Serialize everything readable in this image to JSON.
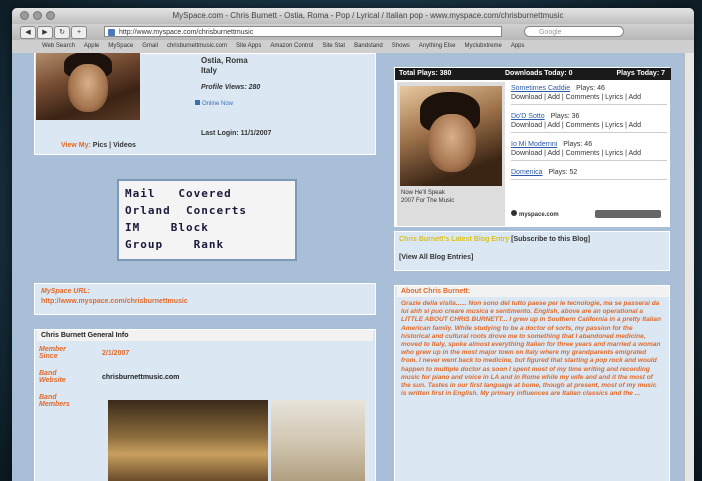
{
  "browser": {
    "window_title": "MySpace.com - Chris Burnett - Ostia, Roma - Pop / Lyrical / Italian pop - www.myspace.com/chrisburnettmusic",
    "url": "http://www.myspace.com/chrisburnettmusic",
    "search_placeholder": "Google",
    "bookmarks": [
      "Web Search",
      "Apple",
      "MySpace",
      "Gmail",
      "chrisburnettmusic.com",
      "Site Apps",
      "Amazon Control",
      "Site Stat",
      "Bandstand",
      "Shows",
      "Anything Else",
      "Myclubxtreme",
      "Apps"
    ]
  },
  "profile": {
    "location_city": "Ostia, Roma",
    "location_country": "Italy",
    "profile_views_label": "Profile Views:",
    "profile_views": "280",
    "online_status": "Online Now",
    "last_login_label": "Last Login:",
    "last_login": "11/1/2007",
    "view_my_label": "View My:",
    "pics_label": "Pics",
    "videos_label": "Videos"
  },
  "banner": {
    "lines": [
      "Mail   Covered",
      "Orland  Concerts",
      "IM    Block",
      "Group    Rank"
    ]
  },
  "url_box": {
    "label": "MySpace URL:",
    "url": "http://www.myspace.com/chrisburnettmusic"
  },
  "general_info": {
    "title": "Chris Burnett General Info",
    "member_since_label": "Member Since",
    "member_since": "2/1/2007",
    "band_website_label": "Band Website",
    "band_website": "chrisburnettmusic.com",
    "band_members_label": "Band Members"
  },
  "player": {
    "header_left": "Total Plays: 380",
    "header_mid": "Downloads Today: 0",
    "header_right": "Plays Today: 7",
    "artist": "Now He'll Speak",
    "album": "2007 For The Music",
    "logo_text": "myspace.com",
    "songs": [
      {
        "title": "Sometimes Caddie",
        "plays": "Plays: 46",
        "actions": "Download | Add | Comments | Lyrics | Add"
      },
      {
        "title": "Do'D Sotto",
        "plays": "Plays: 36",
        "actions": "Download | Add | Comments | Lyrics | Add"
      },
      {
        "title": "Io Mi Modernni",
        "plays": "Plays: 46",
        "actions": "Download | Add | Comments | Lyrics | Add"
      },
      {
        "title": "Domenica",
        "plays": "Plays: 52",
        "actions": ""
      }
    ]
  },
  "blog": {
    "latest": "Chris Burnett's Latest Blog Entry",
    "subscribe": "[Subscribe to this Blog]",
    "view_all": "[View All Blog Entries]"
  },
  "about": {
    "title": "About Chris Burnett:",
    "text": "Grazie della visita...... Non sono del tutto paese per le tecnologie, ma se passerai da lui ahh si puo creare musica e sentimento. English, above are an operational a LITTLE ABOUT CHRIS BURNETT... I grew up in Southern California in a pretty Italian American family. While studying to be a doctor of sorts, my passion for the historical and cultural roots drove me to something that I abandoned medicine, moved to Italy, spoke almost everything Italian for three years and married a woman who grew up in the most major town on Italy where my grandparents emigrated from. I never went back to medicine, but figured that starting a pop rock and would happen to multiple doctor as soon I spent most of my time writing and recording music for piano and voice in LA and in Rome while my wife and and it the most of the sun. Tastes in our first language at home, though at present, most of my music is written first in English. My primary influences are Italian classics and the ..."
  },
  "colors": {
    "page_bg": "#a9bfd7",
    "panel_bg": "#dbe8f4",
    "accent_orange": "#e06a2b",
    "header_dark": "#1a1a1a"
  }
}
